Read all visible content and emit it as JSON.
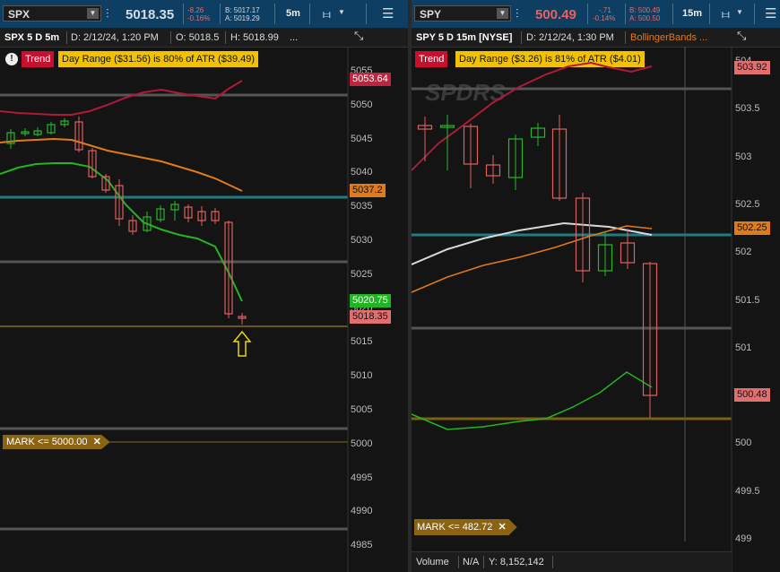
{
  "left": {
    "symbol": "SPX",
    "last": "5018.35",
    "net_change": "-8.26",
    "pct_change": "-0.16%",
    "bid": "B: 5017.17",
    "ask": "A: 5019.29",
    "timeframe": "5m",
    "chart_title": "SPX 5 D 5m",
    "date_info": "D: 2/12/24, 1:20 PM",
    "open_info": "O: 5018.5",
    "high_info": "H: 5018.99",
    "more": "...",
    "trend_label": "Trend",
    "range_text": "Day Range ($31.56) is 80% of ATR ($39.49)",
    "mark_label": "MARK <= 5000.00",
    "price_labels": {
      "upper_band": "5053.64",
      "middle_band": "5037.2",
      "lower_band": "5020.75",
      "last": "5018.35"
    },
    "axis_ticks": [
      "5055",
      "5050",
      "5045",
      "5040",
      "5035",
      "5030",
      "5025",
      "5020",
      "5015",
      "5010",
      "5005",
      "5000",
      "4995",
      "4990",
      "4985"
    ],
    "colors": {
      "up": "#2ab52a",
      "down": "#e06060",
      "upper": "#b0193a",
      "mid": "#e07a1a",
      "lower": "#22b522"
    }
  },
  "right": {
    "symbol": "SPY",
    "last": "500.49",
    "net_change": "-.71",
    "pct_change": "-0.14%",
    "bid": "B: 500.49",
    "ask": "A: 500.50",
    "timeframe": "15m",
    "chart_title": "SPY 5 D 15m [NYSE]",
    "date_info": "D: 2/12/24, 1:30 PM",
    "study_label": "BollingerBands ...",
    "watermark": "SPDRS",
    "trend_label": "Trend",
    "range_text": "Day Range ($3.26) is 81% of ATR ($4.01)",
    "mark_label": "MARK <= 482.72",
    "price_labels": {
      "upper_band": "503.92",
      "middle_band": "502.25",
      "last": "500.48"
    },
    "axis_ticks": [
      "504",
      "503.5",
      "503",
      "502.5",
      "502",
      "501.5",
      "501",
      "500.5",
      "500",
      "499.5",
      "499"
    ],
    "footer": {
      "study": "Volume",
      "value": "N/A",
      "y": "Y: 8,152,142"
    }
  }
}
